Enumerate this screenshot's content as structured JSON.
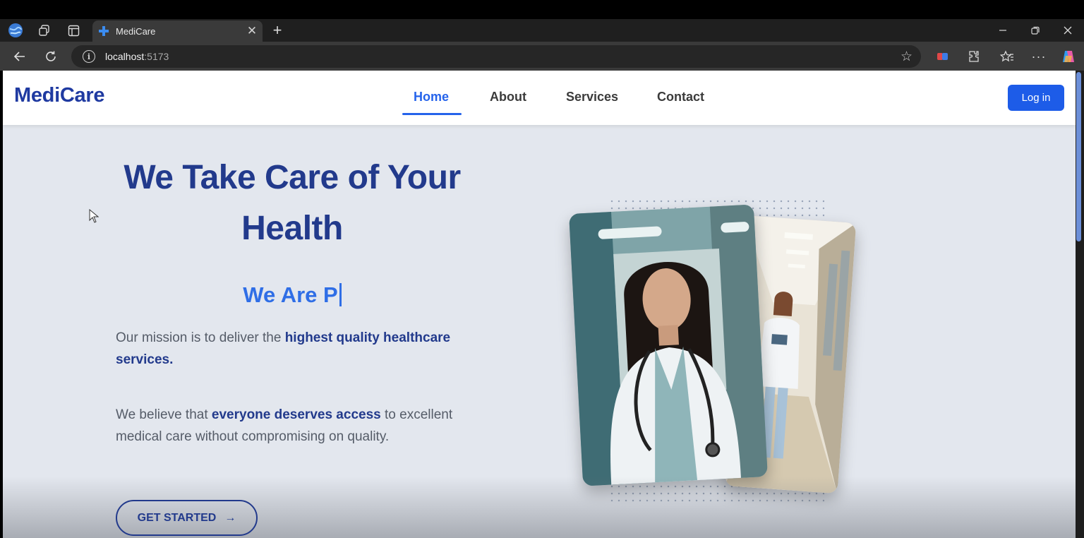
{
  "browser": {
    "tab_title": "MediCare",
    "url_host": "localhost",
    "url_port": ":5173"
  },
  "navbar": {
    "logo": "MediCare",
    "links": [
      "Home",
      "About",
      "Services",
      "Contact"
    ],
    "active_link": "Home",
    "login_label": "Log in"
  },
  "hero": {
    "title_line1": "We Take Care of Your",
    "title_line2": "Health",
    "typed_text": "We Are P",
    "para1_before": "Our mission is to deliver the ",
    "para1_bold": "highest quality healthcare services.",
    "para2_before": "We believe that ",
    "para2_bold": "everyone deserves access",
    "para2_after": " to excellent medical care without compromising on quality.",
    "cta_label": "GET STARTED",
    "cta_arrow": "→"
  },
  "colors": {
    "brand": "#1f3aa1",
    "accent": "#2563eb",
    "page_bg": "#e3e7ee"
  },
  "icons": [
    "profile-globe-icon",
    "workspaces-icon",
    "tab-actions-icon",
    "medical-cross-icon",
    "close-icon",
    "plus-icon",
    "minimize-icon",
    "restore-icon",
    "back-arrow-icon",
    "refresh-icon",
    "info-icon",
    "star-icon",
    "extensions-icon",
    "favorites-icon",
    "more-icon",
    "copilot-icon",
    "arrow-right-icon"
  ]
}
